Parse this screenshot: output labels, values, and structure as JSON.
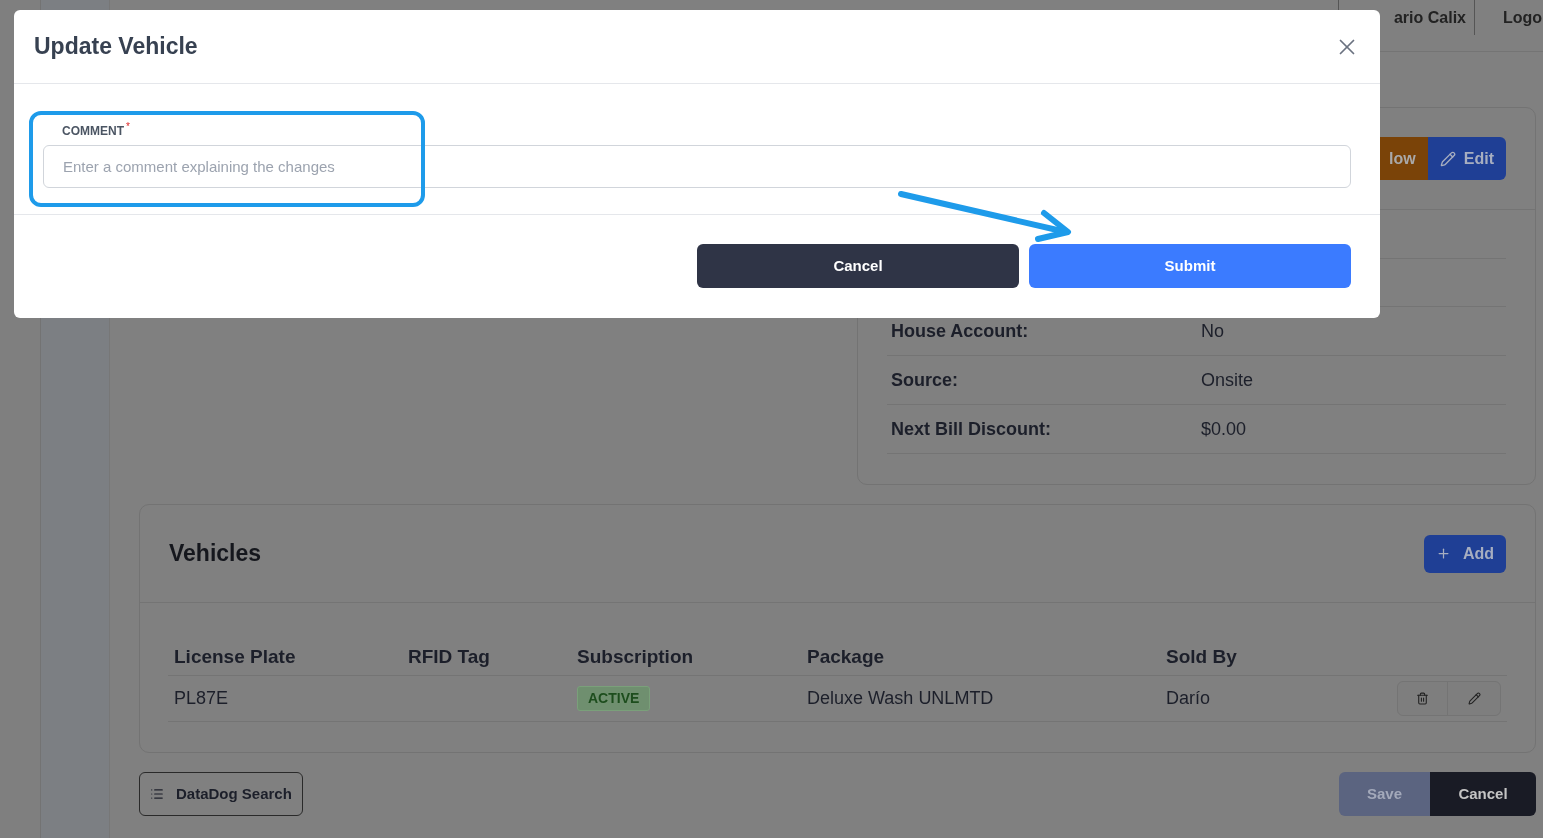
{
  "top_bar": {
    "user": "ario Calix",
    "logout": "Logo"
  },
  "details": {
    "actions": [
      {
        "label": "low",
        "kind": "workflow"
      },
      {
        "label": "Edit",
        "kind": "edit"
      }
    ],
    "rows": [
      {
        "label": "House Account:",
        "value": "No"
      },
      {
        "label": "Source:",
        "value": "Onsite"
      },
      {
        "label": "Next Bill Discount:",
        "value": "$0.00"
      }
    ]
  },
  "vehicles": {
    "title": "Vehicles",
    "add_button": "Add",
    "columns": [
      "License Plate",
      "RFID Tag",
      "Subscription",
      "Package",
      "Sold By"
    ],
    "rows": [
      {
        "license_plate": "PL87E",
        "subscription": "ACTIVE",
        "package": "Deluxe Wash UNLMTD",
        "sold_by": "Darío"
      }
    ]
  },
  "footer": {
    "datadog_button": "DataDog Search",
    "save_button": {
      "label": "Save",
      "disabled": true
    },
    "cancel_button": "Cancel"
  },
  "modal": {
    "title": "Update Vehicle",
    "field": {
      "label": "COMMENT",
      "required_mark": "*",
      "placeholder": "Enter a comment explaining the changes"
    },
    "buttons": [
      {
        "label": "Cancel",
        "kind": "secondary"
      },
      {
        "label": "Submit",
        "kind": "primary"
      }
    ]
  }
}
